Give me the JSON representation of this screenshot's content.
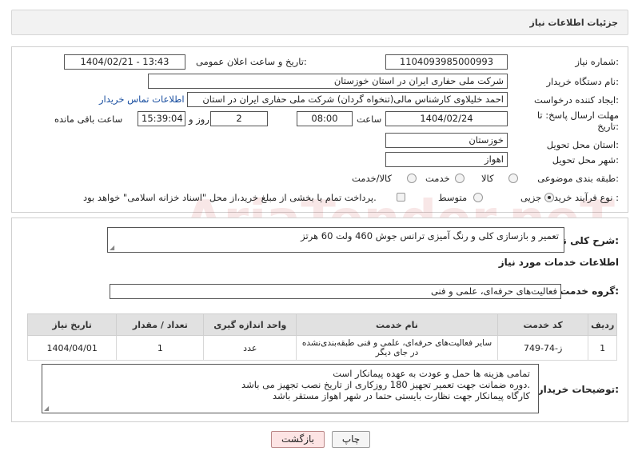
{
  "header": {
    "title": "جزئیات اطلاعات نیاز"
  },
  "fields": {
    "need_number_label": "شماره نیاز:",
    "need_number": "1104093985000993",
    "announce_label": "تاریخ و ساعت اعلان عمومی:",
    "announce_value": "1404/02/21 - 13:43",
    "buyer_label": "نام دستگاه خریدار:",
    "buyer_value": "شرکت ملی حفاری ایران در استان خوزستان",
    "creator_label": "ایجاد کننده درخواست:",
    "creator_value": "احمد خلیلاوی کارشناس مالی(تنخواه گردان) شرکت ملی حفاری ایران در استان",
    "contact_link": "اطلاعات تماس خریدار",
    "deadline_label_1": "مهلت ارسال پاسخ: تا",
    "deadline_label_2": "تاریخ:",
    "deadline_date": "1404/02/24",
    "time_label": "ساعت",
    "deadline_time": "08:00",
    "days_value": "2",
    "days_label": "روز و",
    "remaining_time": "15:39:04",
    "remaining_label": "ساعت باقی مانده",
    "province_label": "استان محل تحویل:",
    "province_value": "خوزستان",
    "city_label": "شهر محل تحویل:",
    "city_value": "اهواز",
    "category_label": "طبقه بندی موضوعی:",
    "category_options": [
      "کالا",
      "خدمت",
      "کالا/خدمت"
    ],
    "process_label": "نوع فرآیند خرید :",
    "process_options": [
      "جزیی",
      "متوسط"
    ],
    "payment_note": "پرداخت تمام یا بخشی از مبلغ خرید،از محل \"اسناد خزانه اسلامی\" خواهد بود."
  },
  "summary": {
    "label": "شرح کلی نیاز:",
    "value": "تعمیر و بازسازی کلی و رنگ آمیزی ترانس جوش 460 ولت 60 هرتز"
  },
  "services": {
    "section_title": "اطلاعات خدمات مورد نیاز",
    "group_label": "گروه خدمت:",
    "group_value": "فعالیت‌های حرفه‌ای، علمی و فنی",
    "columns": [
      "ردیف",
      "کد خدمت",
      "نام خدمت",
      "واحد اندازه گیری",
      "تعداد / مقدار",
      "تاریخ نیاز"
    ],
    "rows": [
      {
        "row": "1",
        "code": "ز-74-749",
        "name": "سایر فعالیت‌های حرفه‌ای، علمی و فنی طبقه‌بندی‌نشده در جای دیگر",
        "unit": "عدد",
        "qty": "1",
        "date": "1404/04/01"
      }
    ]
  },
  "buyer_notes": {
    "label": "توضیحات خریدار:",
    "lines": [
      "تمامی هزینه ها حمل و عودت به عهده پیمانکار است",
      "دوره ضمانت جهت تعمیر تجهیز 180 روزکاری از تاریخ نصب تجهیز می باشد.",
      "کارگاه پیمانکار جهت نظارت بایستی حتما در شهر اهواز مستقر باشد"
    ]
  },
  "buttons": {
    "print": "چاپ",
    "back": "بازگشت"
  },
  "watermark": "AriaTender.neT"
}
